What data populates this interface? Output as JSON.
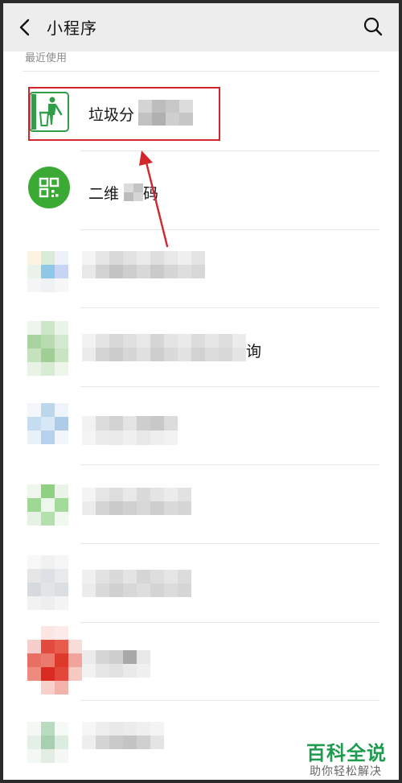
{
  "header": {
    "title": "小程序",
    "back_icon": "chevron-left-icon",
    "search_icon": "search-icon"
  },
  "section": {
    "label": "最近使用"
  },
  "apps": [
    {
      "label": "垃圾分",
      "icon": "trash-bin-icon",
      "icon_color": "#2e9e48",
      "highlighted": true
    },
    {
      "label": "二维",
      "label_tail": "码",
      "icon": "qr-code-icon",
      "icon_color": "#3aaa35"
    },
    {
      "label": "",
      "icon": "blurred-icon"
    },
    {
      "label": "",
      "label_tail": "询",
      "icon": "blurred-icon"
    },
    {
      "label": "",
      "icon": "blurred-icon"
    },
    {
      "label": "",
      "icon": "blurred-icon"
    },
    {
      "label": "",
      "icon": "blurred-icon"
    },
    {
      "label": "",
      "icon": "blurred-icon"
    },
    {
      "label": "",
      "icon": "blurred-icon"
    }
  ],
  "watermark": {
    "title": "百科全说",
    "subtitle": "助你轻松解决"
  },
  "colors": {
    "highlight": "#d2262b",
    "brand_green": "#1e9b4e"
  }
}
